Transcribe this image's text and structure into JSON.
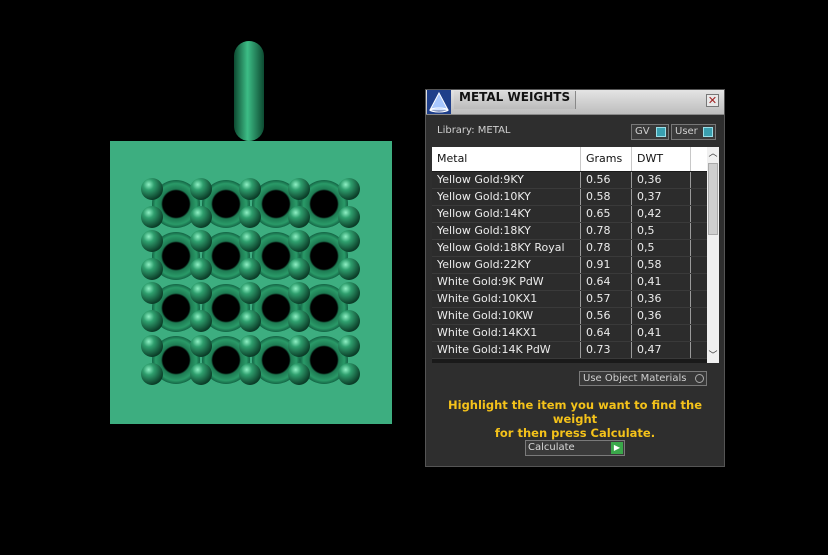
{
  "panel": {
    "title": "METAL WEIGHTS",
    "close_glyph": "✕",
    "library_label": "Library: METAL",
    "toggles": {
      "gv": "GV",
      "user": "User"
    },
    "table": {
      "columns": [
        "Metal",
        "Grams",
        "DWT"
      ],
      "rows": [
        [
          "Yellow Gold:9KY",
          "0.56",
          "0,36"
        ],
        [
          "Yellow Gold:10KY",
          "0.58",
          "0,37"
        ],
        [
          "Yellow Gold:14KY",
          "0.65",
          "0,42"
        ],
        [
          "Yellow Gold:18KY",
          "0.78",
          "0,5"
        ],
        [
          "Yellow Gold:18KY Royal",
          "0.78",
          "0,5"
        ],
        [
          "Yellow Gold:22KY",
          "0.91",
          "0,58"
        ],
        [
          "White Gold:9K PdW",
          "0.64",
          "0,41"
        ],
        [
          "White Gold:10KX1",
          "0.57",
          "0,36"
        ],
        [
          "White Gold:10KW",
          "0.56",
          "0,36"
        ],
        [
          "White Gold:14KX1",
          "0.64",
          "0,41"
        ],
        [
          "White Gold:14K PdW",
          "0.73",
          "0,47"
        ]
      ]
    },
    "use_object_materials": "Use Object Materials",
    "hint_line1": "Highlight the item you want to find the weight",
    "hint_line2": "for then press Calculate.",
    "calculate_label": "Calculate"
  },
  "colors": {
    "model_base": "#3dae80",
    "model_dark": "#136444",
    "hint_text": "#f4c21a",
    "accent": "#3aa0b0"
  },
  "icons": {
    "panel_icon": "pyramid-icon",
    "close": "close-icon",
    "scroll_up": "chevron-up-icon",
    "scroll_down": "chevron-down-icon",
    "calculate_go": "play-icon"
  }
}
